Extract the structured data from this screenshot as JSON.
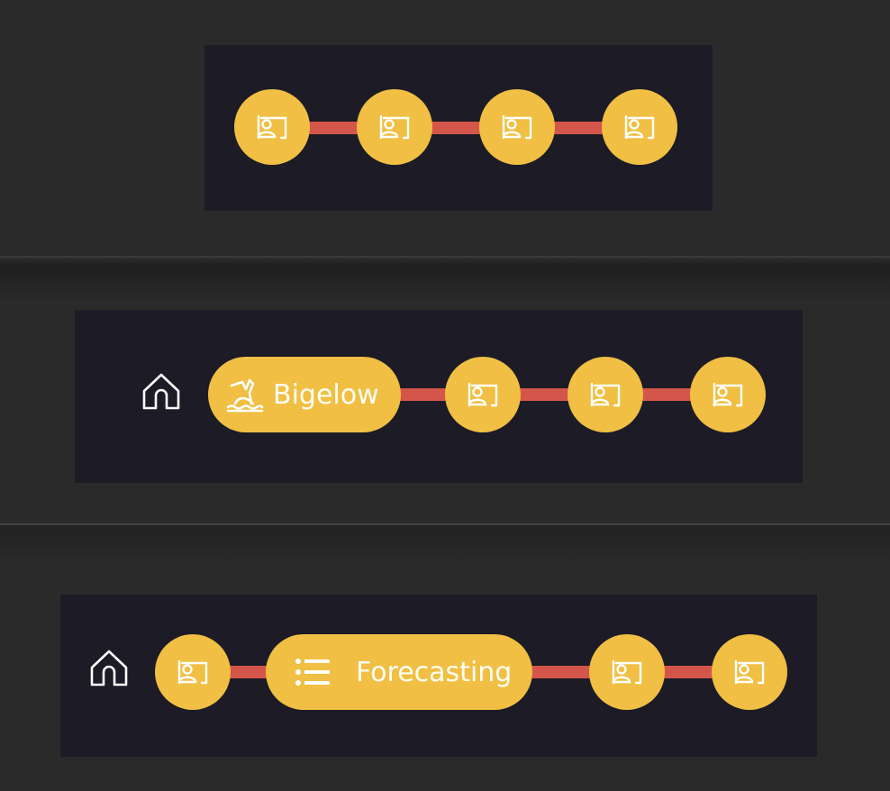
{
  "colors": {
    "background": "#2a2a2a",
    "panel": "#1c1b26",
    "node": "#f0bf43",
    "connector": "#d4554a",
    "icon": "#ffffff"
  },
  "breadcrumb_1": {
    "nodes": [
      "portrait-icon",
      "portrait-icon",
      "portrait-icon",
      "portrait-icon"
    ]
  },
  "breadcrumb_2": {
    "home_icon": "home-icon",
    "active": {
      "icon": "whale-tail-icon",
      "label": "Bigelow"
    },
    "nodes": [
      "portrait-icon",
      "portrait-icon",
      "portrait-icon"
    ]
  },
  "breadcrumb_3": {
    "home_icon": "home-icon",
    "nodes_before": [
      "portrait-icon"
    ],
    "active": {
      "icon": "list-icon",
      "label": "Forecasting"
    },
    "nodes_after": [
      "portrait-icon",
      "portrait-icon"
    ]
  }
}
